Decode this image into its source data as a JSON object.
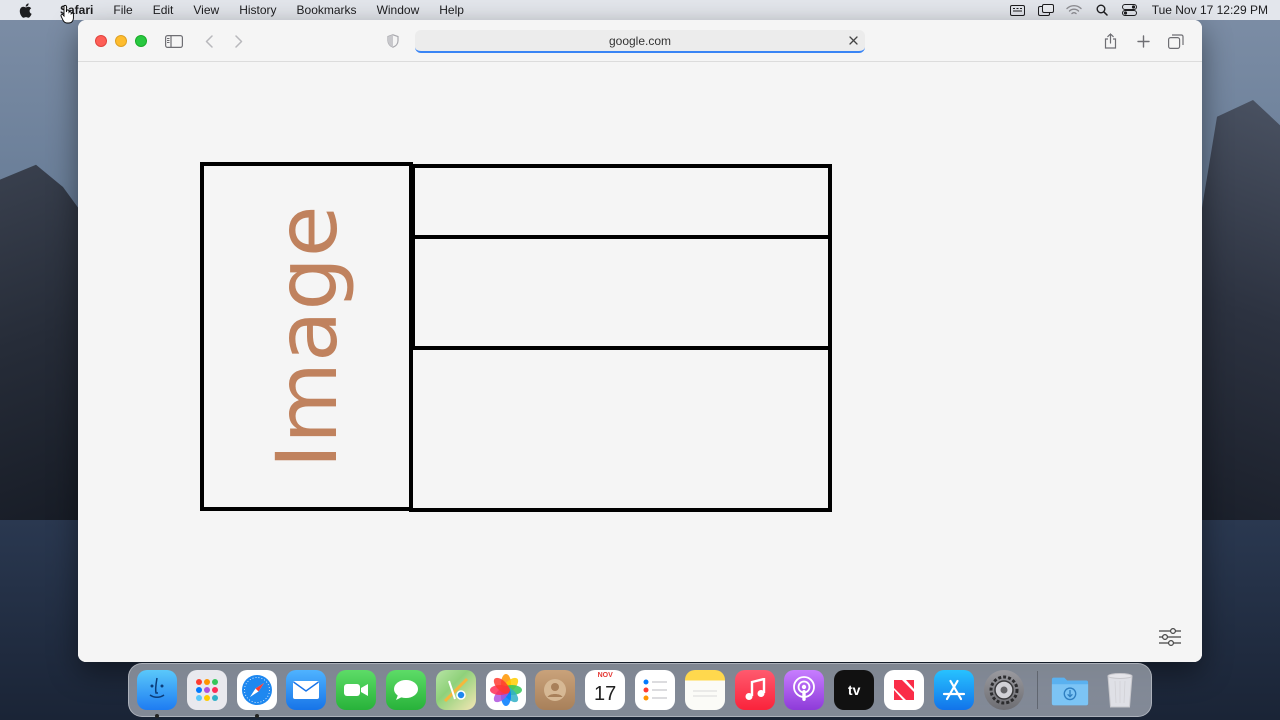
{
  "menubar": {
    "app_name": "Safari",
    "items": [
      "File",
      "Edit",
      "View",
      "History",
      "Bookmarks",
      "Window",
      "Help"
    ],
    "clock": "Tue Nov 17  12:29 PM",
    "status_icons": [
      "keyboard-icon",
      "screen-mirroring-icon",
      "wifi-icon",
      "spotlight-search-icon",
      "control-center-icon"
    ]
  },
  "browser": {
    "url": "google.com"
  },
  "page": {
    "image_placeholder_label": "Image"
  },
  "dock": {
    "apps": [
      "Finder",
      "Launchpad",
      "Safari",
      "Mail",
      "FaceTime",
      "Messages",
      "Maps",
      "Photos",
      "Contacts",
      "Calendar",
      "Reminders",
      "Notes",
      "Music",
      "Podcasts",
      "TV",
      "News",
      "App Store",
      "System Preferences",
      "Downloads",
      "Trash"
    ],
    "calendar_month": "NOV",
    "calendar_day": "17",
    "tv_label": "tv",
    "running": [
      "Finder",
      "Safari"
    ]
  },
  "colors": {
    "accent": "#3a85f5",
    "image_label": "#c0825e"
  }
}
